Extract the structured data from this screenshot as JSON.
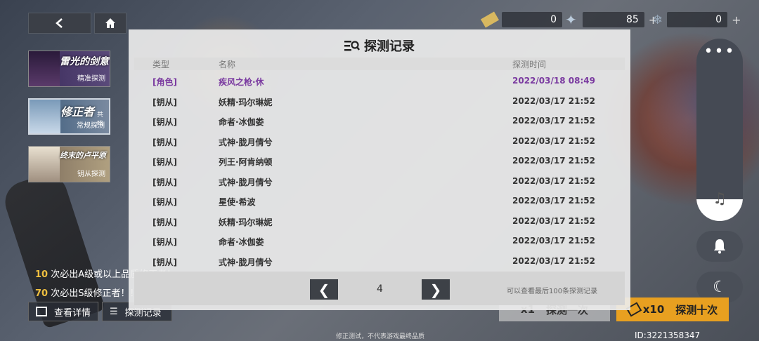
{
  "currency": [
    {
      "icon": "ticket-icon",
      "value": "0"
    },
    {
      "icon": "star-crystal-icon",
      "value": "85"
    },
    {
      "icon": "snowflake-crystal-icon",
      "value": "0"
    }
  ],
  "banners": [
    {
      "title": "雷光的剑意",
      "sub": "精准探测"
    },
    {
      "title": "修正者",
      "badge": "共鸣",
      "sub": "常规探测"
    },
    {
      "title": "终末的卢平原",
      "sub": "钥从探测"
    }
  ],
  "tips": [
    {
      "count": "10",
      "text": "次必出A级或以上品质修正者！"
    },
    {
      "count": "70",
      "text": "次必出S级修正者！！"
    }
  ],
  "bottom": {
    "details": "查看详情",
    "records": "探测记录"
  },
  "draw": {
    "single_multiplier": "x1",
    "single_label": "探测一次",
    "ten_multiplier": "x10",
    "ten_label": "探测十次"
  },
  "user_id": "ID:3221358347",
  "disclaimer": "修正测试，不代表游戏最终品质",
  "modal": {
    "title": "探测记录",
    "headers": {
      "type": "类型",
      "name": "名称",
      "time": "探测时间"
    },
    "rows": [
      {
        "type": "[角色]",
        "name": "疾风之枪·休",
        "time": "2022/03/18 08:49"
      },
      {
        "type": "[钥从]",
        "name": "妖精·玛尔琳妮",
        "time": "2022/03/17 21:52"
      },
      {
        "type": "[钥从]",
        "name": "命者·冰伽娄",
        "time": "2022/03/17 21:52"
      },
      {
        "type": "[钥从]",
        "name": "式神·胧月倩兮",
        "time": "2022/03/17 21:52"
      },
      {
        "type": "[钥从]",
        "name": "列王·阿肯纳顿",
        "time": "2022/03/17 21:52"
      },
      {
        "type": "[钥从]",
        "name": "式神·胧月倩兮",
        "time": "2022/03/17 21:52"
      },
      {
        "type": "[钥从]",
        "name": "星使·希波",
        "time": "2022/03/17 21:52"
      },
      {
        "type": "[钥从]",
        "name": "妖精·玛尔琳妮",
        "time": "2022/03/17 21:52"
      },
      {
        "type": "[钥从]",
        "name": "命者·冰伽娄",
        "time": "2022/03/17 21:52"
      },
      {
        "type": "[钥从]",
        "name": "式神·胧月倩兮",
        "time": "2022/03/17 21:52"
      }
    ],
    "page": "4",
    "note": "可以查看最后100条探测记录"
  },
  "colors": {
    "highlight_row": "#7a3aa0",
    "draw_gold": "#e8a020"
  }
}
